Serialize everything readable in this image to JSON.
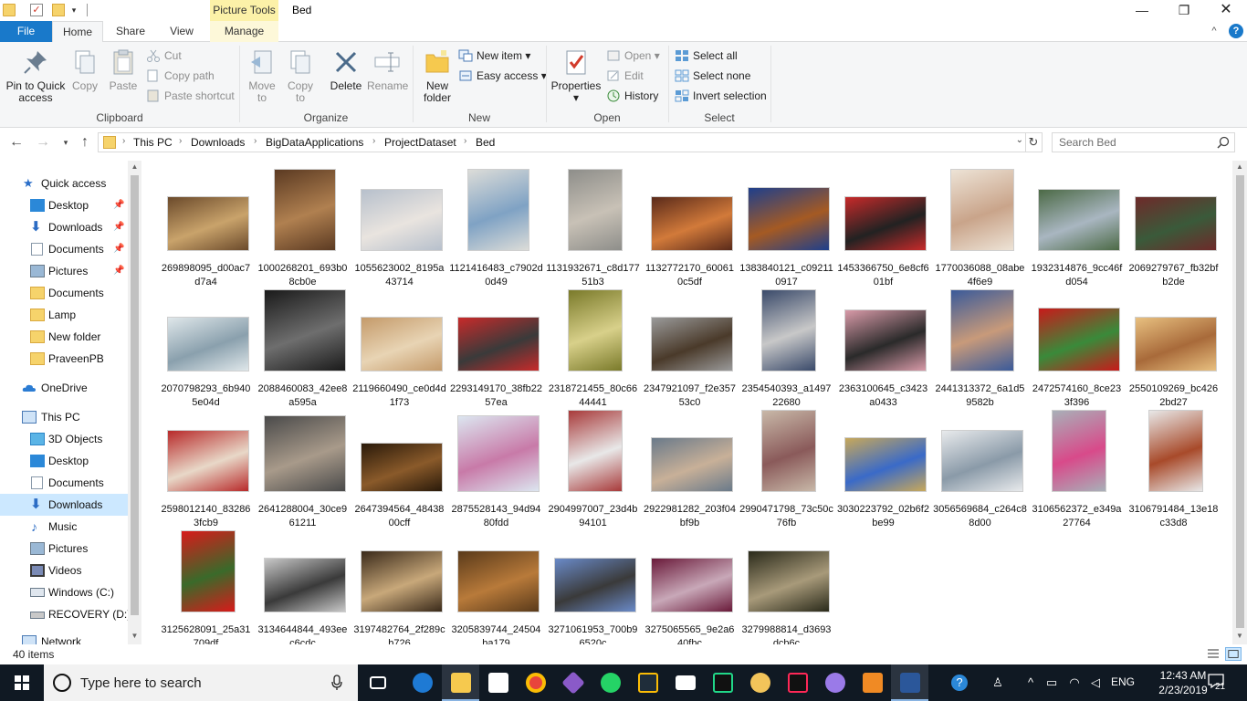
{
  "window": {
    "title": "Bed",
    "context_tab_title": "Picture Tools"
  },
  "ribbon_tabs": {
    "file": "File",
    "home": "Home",
    "share": "Share",
    "view": "View",
    "manage": "Manage"
  },
  "ribbon": {
    "clipboard": {
      "label": "Clipboard",
      "pin": "Pin to Quick access",
      "copy": "Copy",
      "paste": "Paste",
      "cut": "Cut",
      "copy_path": "Copy path",
      "paste_shortcut": "Paste shortcut"
    },
    "organize": {
      "label": "Organize",
      "move_to": "Move to",
      "copy_to": "Copy to",
      "delete": "Delete",
      "rename": "Rename"
    },
    "new": {
      "label": "New",
      "new_folder": "New folder",
      "new_item": "New item",
      "easy_access": "Easy access"
    },
    "open": {
      "label": "Open",
      "properties": "Properties",
      "open": "Open",
      "edit": "Edit",
      "history": "History"
    },
    "select": {
      "label": "Select",
      "select_all": "Select all",
      "select_none": "Select none",
      "invert_selection": "Invert selection"
    }
  },
  "address": {
    "breadcrumbs": [
      "This PC",
      "Downloads",
      "BigDataApplications",
      "ProjectDataset",
      "Bed"
    ],
    "search_placeholder": "Search Bed"
  },
  "sidebar": {
    "quick_access": "Quick access",
    "quick_items": [
      "Desktop",
      "Downloads",
      "Documents",
      "Pictures",
      "Documents",
      "Lamp",
      "New folder",
      "PraveenPB"
    ],
    "onedrive": "OneDrive",
    "this_pc": "This PC",
    "pc_items": [
      "3D Objects",
      "Desktop",
      "Documents",
      "Downloads",
      "Music",
      "Pictures",
      "Videos",
      "Windows (C:)",
      "RECOVERY (D:)"
    ],
    "network": "Network",
    "selected_item": "Downloads"
  },
  "files": [
    {
      "name": "269898095_d00ac7d7a4",
      "colors": [
        "#6b4a2b",
        "#c9a36b"
      ]
    },
    {
      "name": "1000268201_693b08cb0e",
      "colors": [
        "#5b3a22",
        "#b08050"
      ]
    },
    {
      "name": "1055623002_8195a43714",
      "colors": [
        "#b7c0cc",
        "#e9e4df"
      ]
    },
    {
      "name": "1121416483_c7902d0d49",
      "colors": [
        "#dcdcd8",
        "#7fa2c4"
      ]
    },
    {
      "name": "1131932671_c8d17751b3",
      "colors": [
        "#8e8e8a",
        "#c8c1b6"
      ]
    },
    {
      "name": "1132772170_600610c5df",
      "colors": [
        "#5a2a1a",
        "#d27a3a"
      ]
    },
    {
      "name": "1383840121_c092110917",
      "colors": [
        "#1e3f8c",
        "#a55a23"
      ]
    },
    {
      "name": "1453366750_6e8cf601bf",
      "colors": [
        "#c82a2a",
        "#222"
      ]
    },
    {
      "name": "1770036088_08abe4f6e9",
      "colors": [
        "#ede3d6",
        "#c9a48a"
      ]
    },
    {
      "name": "1932314876_9cc46fd054",
      "colors": [
        "#4c6a46",
        "#a9b6c1"
      ]
    },
    {
      "name": "2069279767_fb32bfb2de",
      "colors": [
        "#6e2a2a",
        "#3a5a3a"
      ]
    },
    {
      "name": "2070798293_6b9405e04d",
      "colors": [
        "#dfe7ea",
        "#8aa0ad"
      ]
    },
    {
      "name": "2088460083_42ee8a595a",
      "colors": [
        "#1a1a1a",
        "#6e6e6e"
      ]
    },
    {
      "name": "2119660490_ce0d4d1f73",
      "colors": [
        "#c49a6a",
        "#e8d4b4"
      ]
    },
    {
      "name": "2293149170_38fb2257ea",
      "colors": [
        "#c82a2a",
        "#3a3a3a"
      ]
    },
    {
      "name": "2318721455_80c6644441",
      "colors": [
        "#7a7a2a",
        "#d8d08a"
      ]
    },
    {
      "name": "2347921097_f2e35753c0",
      "colors": [
        "#9a9a9a",
        "#4a3a2a"
      ]
    },
    {
      "name": "2354540393_a149722680",
      "colors": [
        "#3a4a6a",
        "#c8c8c8"
      ]
    },
    {
      "name": "2363100645_c3423a0433",
      "colors": [
        "#d89aa8",
        "#2a2a2a"
      ]
    },
    {
      "name": "2441313372_6a1d59582b",
      "colors": [
        "#3a5a9a",
        "#c89a7a"
      ]
    },
    {
      "name": "2472574160_8ce233f396",
      "colors": [
        "#c81a1a",
        "#3a8a3a"
      ]
    },
    {
      "name": "2550109269_bc4262bd27",
      "colors": [
        "#e8c080",
        "#a86a3a"
      ]
    },
    {
      "name": "2598012140_832863fcb9",
      "colors": [
        "#b82a2a",
        "#e8d8c8"
      ]
    },
    {
      "name": "2641288004_30ce961211",
      "colors": [
        "#4a4a4a",
        "#a89a8a"
      ]
    },
    {
      "name": "2647394564_4843800cff",
      "colors": [
        "#2a1a0a",
        "#8a5a2a"
      ]
    },
    {
      "name": "2875528143_94d9480fdd",
      "colors": [
        "#dce6f0",
        "#c87aa8"
      ]
    },
    {
      "name": "2904997007_23d4b94101",
      "colors": [
        "#a83a3a",
        "#e8e8e8"
      ]
    },
    {
      "name": "2922981282_203f04bf9b",
      "colors": [
        "#6a7a8a",
        "#c8b098"
      ]
    },
    {
      "name": "2990471798_73c50c76fb",
      "colors": [
        "#c8b8a8",
        "#8a5a5a"
      ]
    },
    {
      "name": "3030223792_02b6f2be99",
      "colors": [
        "#c8a85a",
        "#3a6ac8"
      ]
    },
    {
      "name": "3056569684_c264c88d00",
      "colors": [
        "#e8eaec",
        "#8a9aa8"
      ]
    },
    {
      "name": "3106562372_e349a27764",
      "colors": [
        "#a8b0b8",
        "#d84a8a"
      ]
    },
    {
      "name": "3106791484_13e18c33d8",
      "colors": [
        "#e8e8e8",
        "#a84a2a"
      ]
    },
    {
      "name": "3125628091_25a31709df",
      "colors": [
        "#d81a1a",
        "#3a6a2a"
      ]
    },
    {
      "name": "3134644844_493eec6cdc",
      "colors": [
        "#c8c8c8",
        "#3a3a3a"
      ]
    },
    {
      "name": "3197482764_2f289cb726",
      "colors": [
        "#3a2a1a",
        "#c8a87a"
      ]
    },
    {
      "name": "3205839744_24504ba179",
      "colors": [
        "#5a3a1a",
        "#b87a3a"
      ]
    },
    {
      "name": "3271061953_700b96520c",
      "colors": [
        "#6a8ac8",
        "#3a3a3a"
      ]
    },
    {
      "name": "3275065565_9e2a640fbc",
      "colors": [
        "#6a1a3a",
        "#c8a8b8"
      ]
    },
    {
      "name": "3279988814_d3693dcb6c",
      "colors": [
        "#2a2a1a",
        "#a89a7a"
      ]
    }
  ],
  "status": {
    "item_count": "40 items"
  },
  "taskbar": {
    "search_placeholder": "Type here to search",
    "language": "ENG",
    "time": "12:43 AM",
    "date": "2/23/2019",
    "notifications": "21"
  },
  "colors": {
    "accent": "#1979ca",
    "selection": "#cce8ff",
    "taskbar": "#101923"
  }
}
